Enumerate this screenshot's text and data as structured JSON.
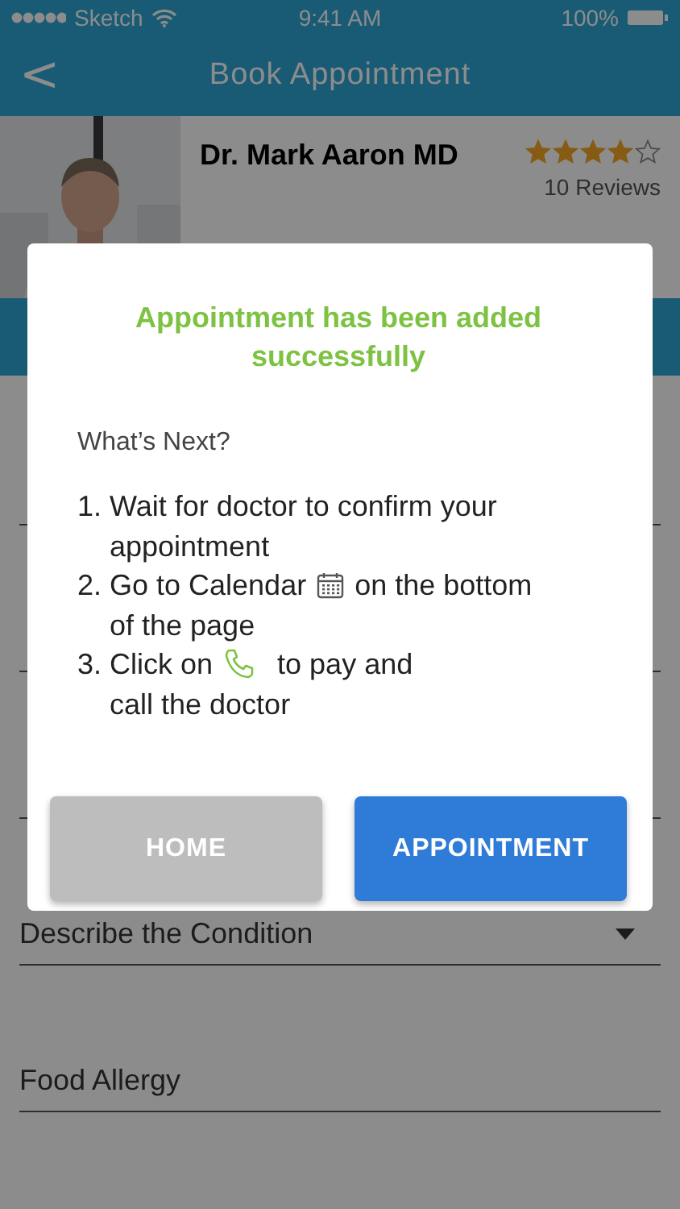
{
  "status_bar": {
    "carrier": "Sketch",
    "time": "9:41 AM",
    "battery": "100%"
  },
  "nav": {
    "back": "<",
    "title": "Book Appointment"
  },
  "doctor": {
    "name": "Dr. Mark Aaron MD",
    "stars": 4,
    "reviews": "10 Reviews"
  },
  "fields": [
    {
      "kind": "text"
    },
    {
      "kind": "text"
    },
    {
      "kind": "text"
    },
    {
      "label": "Describe the Condition",
      "kind": "dropdown"
    },
    {
      "label": "Food Allergy",
      "kind": "text"
    }
  ],
  "dialog": {
    "title": "Appointment has been added successfully",
    "subtitle": "What’s Next?",
    "steps": [
      {
        "number": "1.",
        "lines": [
          [
            {
              "kind": "text",
              "text": "Wait for doctor to confirm your"
            }
          ],
          [
            {
              "kind": "text",
              "text": "appointment"
            }
          ]
        ]
      },
      {
        "number": "2.",
        "lines": [
          [
            {
              "kind": "text",
              "text": "Go to Calendar"
            },
            {
              "kind": "calendar"
            },
            {
              "kind": "text",
              "text": "on the bottom"
            }
          ],
          [
            {
              "kind": "text",
              "text": "of the page"
            }
          ]
        ]
      },
      {
        "number": "3.",
        "lines": [
          [
            {
              "kind": "text",
              "text": "Click on"
            },
            {
              "kind": "phone"
            },
            {
              "kind": "text",
              "text": "to pay and"
            }
          ],
          [
            {
              "kind": "text",
              "text": "call the doctor"
            }
          ]
        ]
      }
    ],
    "buttons": [
      {
        "label": "HOME",
        "kind": "secondary"
      },
      {
        "label": "APPOINTMENT",
        "kind": "primary"
      }
    ]
  }
}
